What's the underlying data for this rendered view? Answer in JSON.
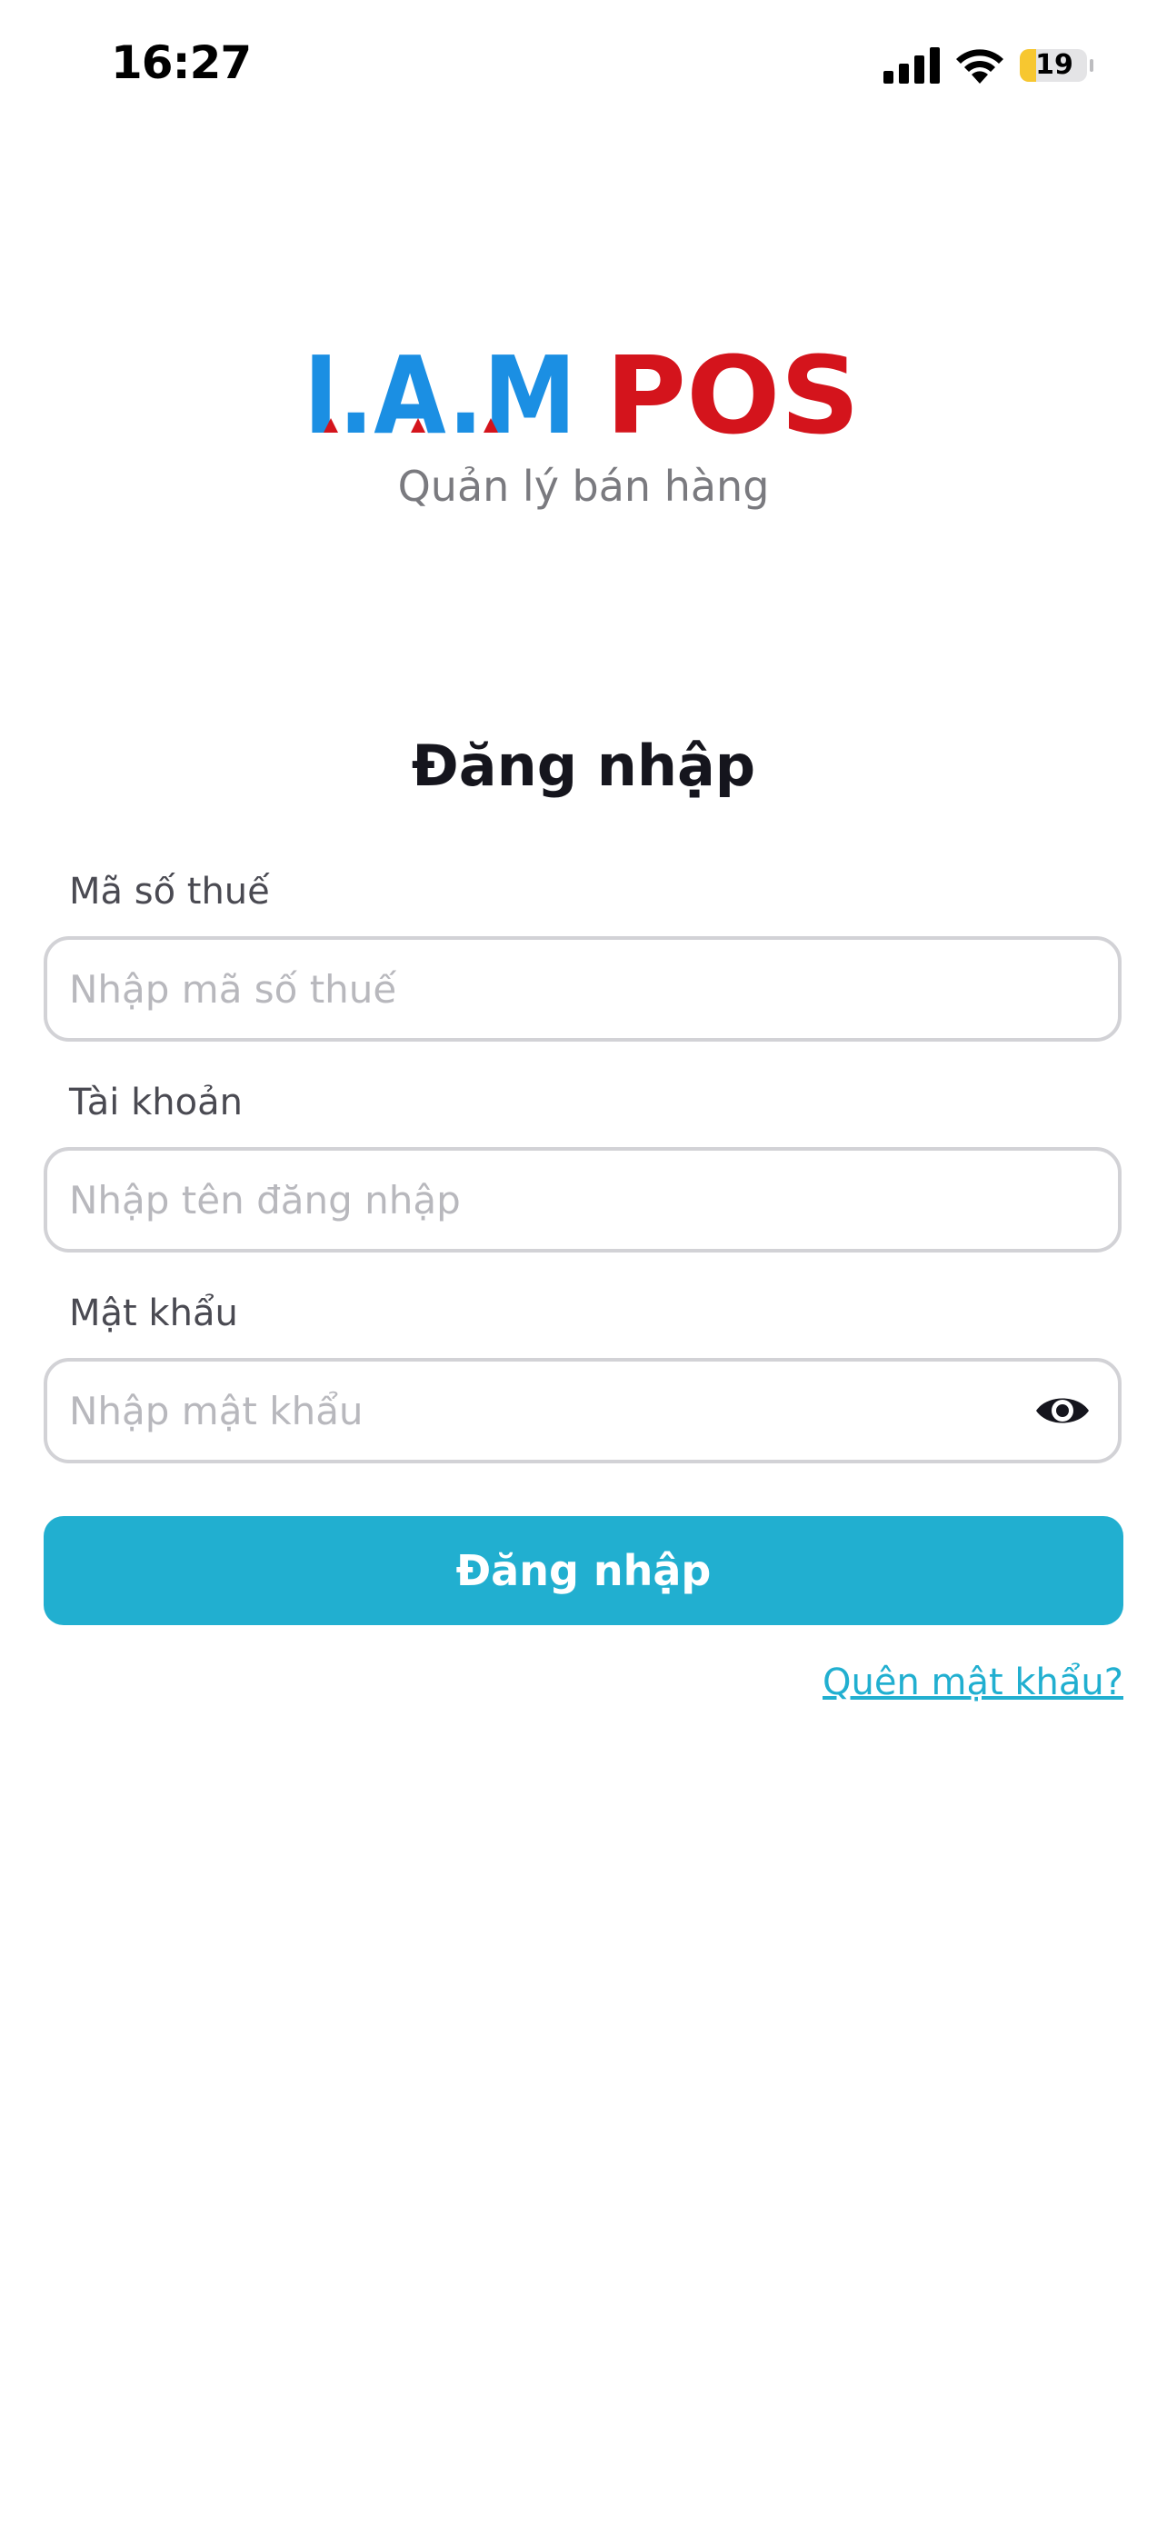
{
  "status_bar": {
    "time": "16:27",
    "battery_level": "19",
    "signal_icon": "cellular-signal-icon",
    "wifi_icon": "wifi-icon",
    "battery_icon": "battery-icon"
  },
  "brand": {
    "logo_left": "I.A.M",
    "logo_right": "POS",
    "subtitle": "Quản lý bán hàng",
    "colors": {
      "blue": "#1b8fe3",
      "red": "#d4141c",
      "accent": "#21afd0"
    }
  },
  "form": {
    "title": "Đăng nhập",
    "tax_code": {
      "label": "Mã số thuế",
      "placeholder": "Nhập mã số thuế",
      "value": ""
    },
    "account": {
      "label": "Tài khoản",
      "placeholder": "Nhập tên đăng nhập",
      "value": ""
    },
    "password": {
      "label": "Mật khẩu",
      "placeholder": "Nhập mật khẩu",
      "value": "",
      "toggle_icon": "eye-icon"
    },
    "submit_label": "Đăng nhập",
    "forgot_password_label": "Quên mật khẩu?"
  }
}
